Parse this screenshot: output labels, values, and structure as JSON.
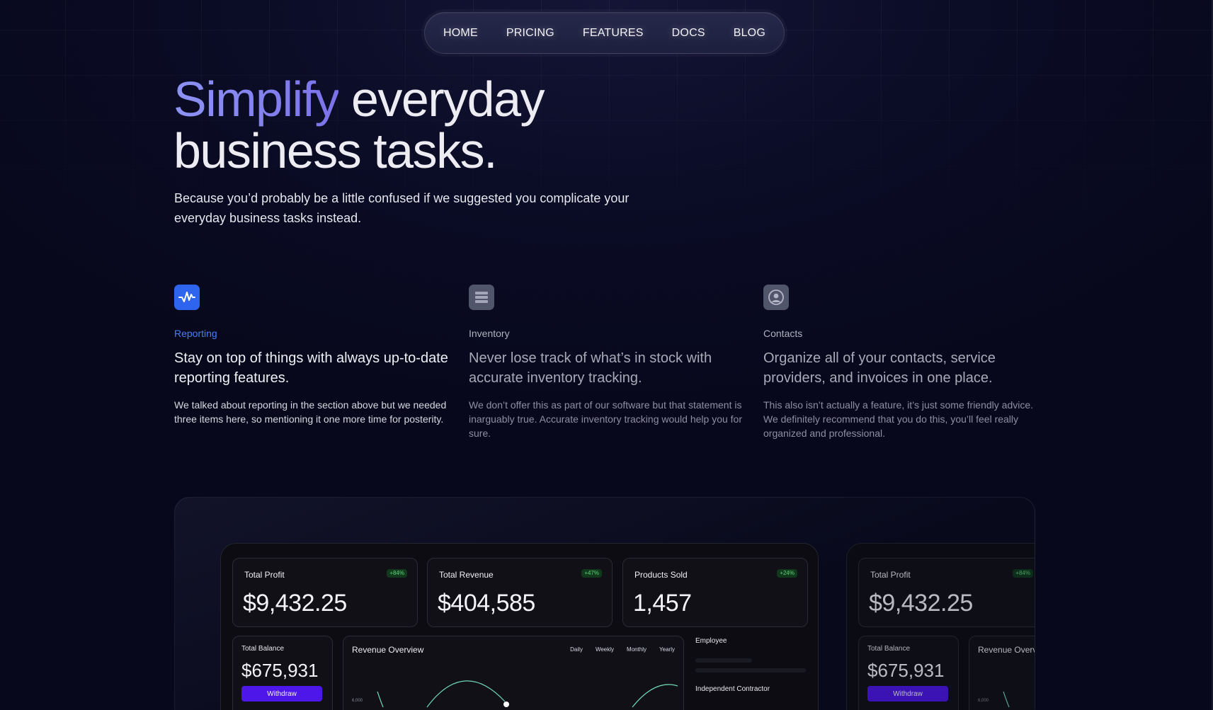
{
  "nav": {
    "items": [
      {
        "label": "HOME"
      },
      {
        "label": "PRICING"
      },
      {
        "label": "FEATURES"
      },
      {
        "label": "DOCS"
      },
      {
        "label": "BLOG"
      }
    ]
  },
  "hero": {
    "title_accent": "Simplify",
    "title_rest_line1": " everyday",
    "title_line2": "business tasks.",
    "subtitle": "Because you’d probably be a little confused if we suggested you complicate your everyday business tasks instead."
  },
  "features": [
    {
      "icon": "activity-icon",
      "tag": "Reporting",
      "heading": "Stay on top of things with always up-to-date reporting features.",
      "description": "We talked about reporting in the section above but we needed three items here, so mentioning it one more time for posterity."
    },
    {
      "icon": "inventory-icon",
      "tag": "Inventory",
      "heading": "Never lose track of what’s in stock with accurate inventory tracking.",
      "description": "We don’t offer this as part of our software but that statement is inarguably true. Accurate inventory tracking would help you for sure."
    },
    {
      "icon": "contact-icon",
      "tag": "Contacts",
      "heading": "Organize all of your contacts, service providers, and invoices in one place.",
      "description": "This also isn’t actually a feature, it’s just some friendly advice. We definitely recommend that you do this, you’ll feel really organized and professional."
    }
  ],
  "dashboard": {
    "stats": [
      {
        "label": "Total Profit",
        "value": "$9,432.25",
        "change": "+84%"
      },
      {
        "label": "Total Revenue",
        "value": "$404,585",
        "change": "+47%"
      },
      {
        "label": "Products Sold",
        "value": "1,457",
        "change": "+24%"
      }
    ],
    "balance": {
      "label": "Total Balance",
      "value": "$675,931",
      "button": "Withdraw"
    },
    "revenue": {
      "title": "Revenue Overview",
      "periods": [
        "Daily",
        "Weekly",
        "Monthly",
        "Yearly"
      ],
      "tick": "6,000"
    },
    "employment": {
      "employee": "Employee",
      "contractor": "Independent Contractor"
    },
    "secondary": {
      "stat_label": "Total Profit",
      "stat_value": "$9,432.25",
      "stat_change": "+84%",
      "balance_label": "Total Balance",
      "balance_value": "$675,931",
      "button": "Withdraw",
      "revenue_title": "Revenue Overview",
      "tick": "6,000"
    }
  },
  "colors": {
    "accent_blue": "#2f64ee",
    "accent_purple": "#4c17e8",
    "positive": "#5fd37a",
    "chart_line": "#6fd6b4"
  }
}
